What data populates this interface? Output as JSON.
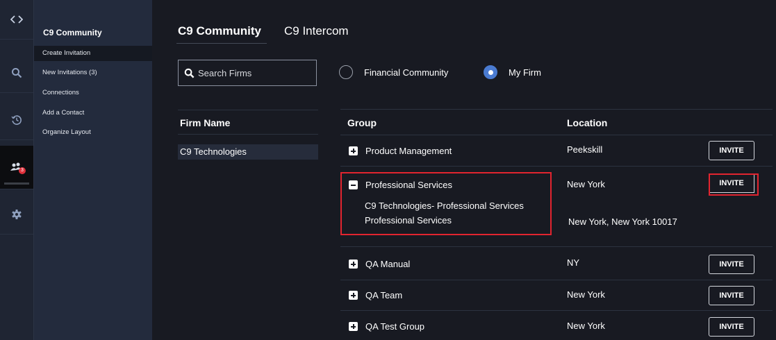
{
  "rail": {
    "icons": [
      "code-toggle-icon",
      "search-icon",
      "history-icon",
      "community-icon",
      "gear-icon"
    ],
    "community_badge": "3"
  },
  "nav": {
    "title": "C9 Community",
    "items": [
      {
        "label": "Create Invitation",
        "selected": true
      },
      {
        "label": "New Invitations (3)",
        "selected": false
      },
      {
        "label": "Connections",
        "selected": false
      },
      {
        "label": "Add a Contact",
        "selected": false
      },
      {
        "label": "Organize Layout",
        "selected": false
      }
    ]
  },
  "tabs": {
    "active": "C9 Community",
    "other": "C9 Intercom"
  },
  "search": {
    "placeholder": "Search Firms",
    "value": ""
  },
  "filters": {
    "options": [
      {
        "label": "Financial Community",
        "selected": false
      },
      {
        "label": "My Firm",
        "selected": true
      }
    ]
  },
  "firms": {
    "header": "Firm Name",
    "rows": [
      "C9 Technologies"
    ]
  },
  "groups": {
    "headers": {
      "group": "Group",
      "location": "Location"
    },
    "invite_label": "INVITE",
    "rows": [
      {
        "name": "Product Management",
        "location": "Peekskill",
        "expanded": false
      },
      {
        "name": "Professional Services",
        "location": "New York",
        "expanded": true,
        "detail": {
          "line1": "C9 Technologies- Professional Services",
          "line2": "Professional Services",
          "location": "New York, New York 10017"
        }
      },
      {
        "name": "QA Manual",
        "location": "NY",
        "expanded": false
      },
      {
        "name": "QA Team",
        "location": "New York",
        "expanded": false
      },
      {
        "name": "QA Test Group",
        "location": "New York",
        "expanded": false
      }
    ]
  },
  "colors": {
    "accent": "#4a7bd1",
    "highlight": "#e2242f",
    "badge": "#e0313c"
  }
}
